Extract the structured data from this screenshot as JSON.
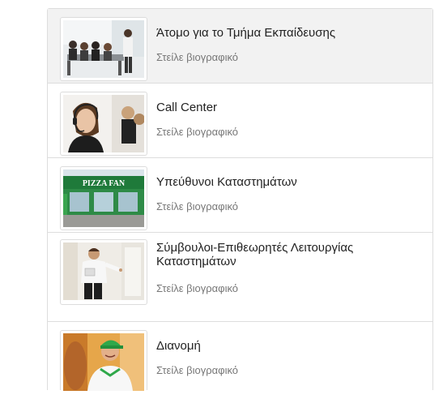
{
  "jobs": [
    {
      "title": "Άτομο για το Τμήμα Εκπαίδευσης",
      "link_label": "Στείλε βιογραφικό",
      "image": "training-meeting-photo"
    },
    {
      "title": "Call Center",
      "link_label": "Στείλε βιογραφικό",
      "image": "call-center-headset-photo"
    },
    {
      "title": "Υπεύθυνοι Καταστημάτων",
      "link_label": "Στείλε βιογραφικό",
      "image": "pizza-fan-storefront-photo"
    },
    {
      "title": "Σύμβουλοι-Επιθεωρητές Λειτουργίας Καταστημάτων",
      "link_label": "Στείλε βιογραφικό",
      "image": "inspector-with-tablet-photo"
    },
    {
      "title": "Διανομή",
      "link_label": "Στείλε βιογραφικό",
      "image": "delivery-person-photo"
    }
  ],
  "storefront_sign": "PIZZA FAN"
}
